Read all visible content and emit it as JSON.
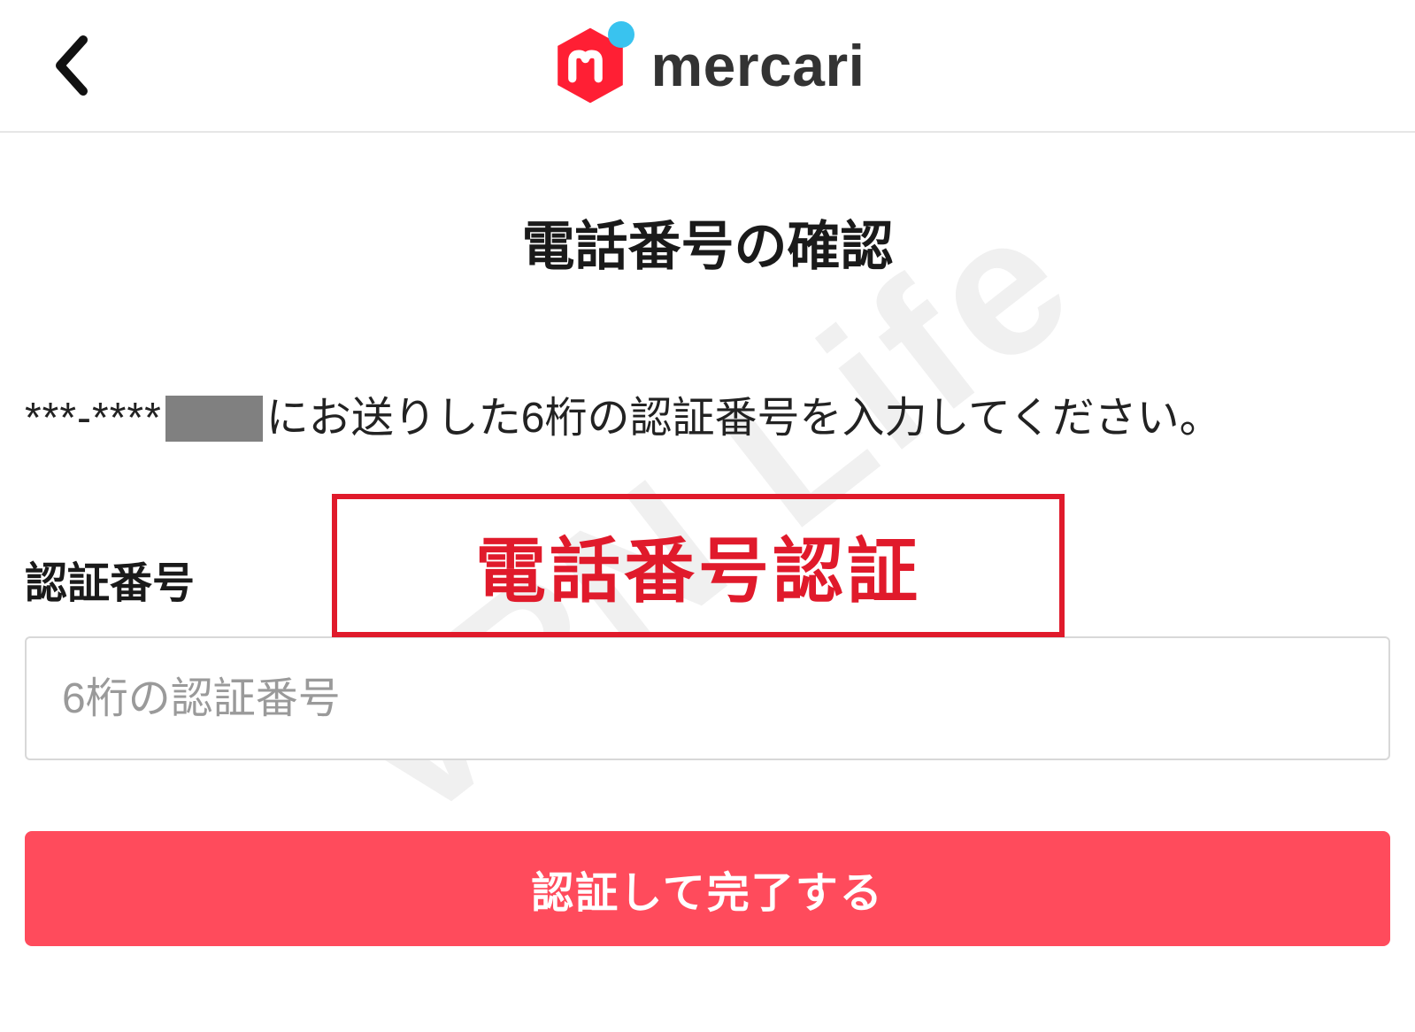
{
  "header": {
    "brand_text": "mercari"
  },
  "page": {
    "title": "電話番号の確認",
    "instruction_prefix_masked": "***-****",
    "instruction_text": "にお送りした6桁の認証番号を入力してください。"
  },
  "form": {
    "code_label": "認証番号",
    "code_placeholder": "6桁の認証番号",
    "code_value": "",
    "submit_label": "認証して完了する"
  },
  "annotation": {
    "box_text": "電話番号認証"
  },
  "watermark": {
    "text": "VPN Life"
  },
  "colors": {
    "brand_red": "#ff3340",
    "brand_blue_dot": "#39c3ef",
    "submit_button": "#ff4b5c",
    "annotation_red": "#e01a2b"
  }
}
